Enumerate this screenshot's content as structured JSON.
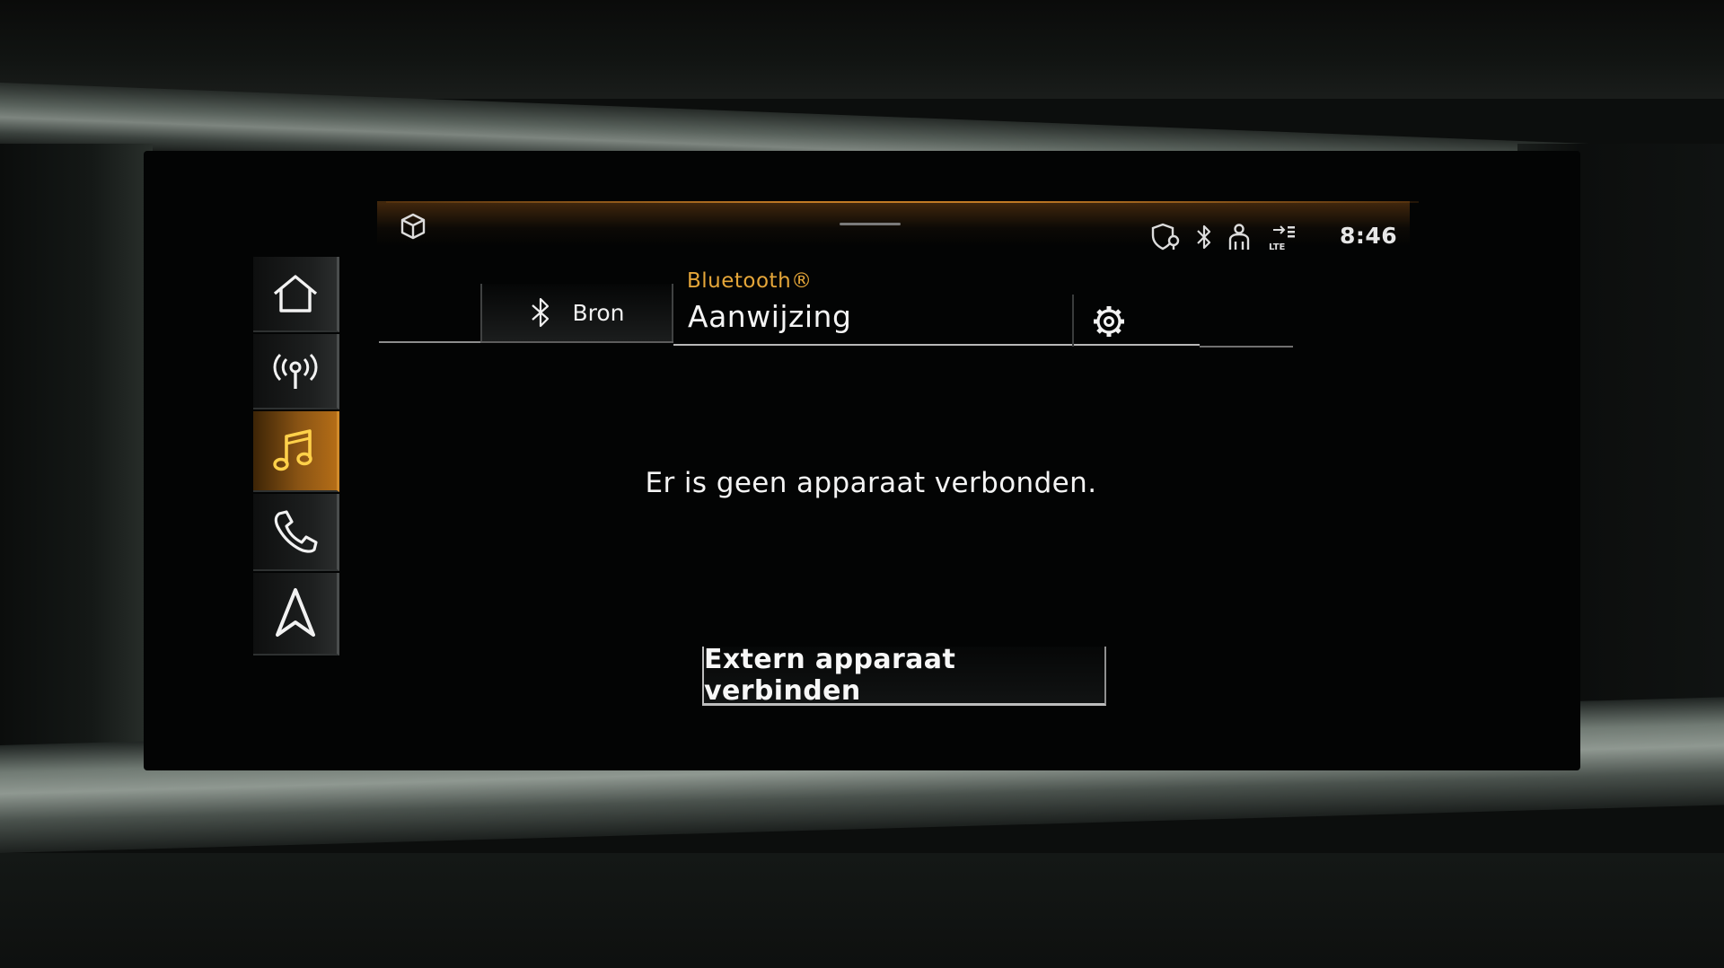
{
  "status_bar": {
    "time": "8:46",
    "icons": [
      "cube-icon",
      "shield-location-icon",
      "bluetooth-icon",
      "person-icon",
      "lte-signal-icon"
    ]
  },
  "nav_rail": {
    "items": [
      {
        "icon": "home-icon",
        "active": false
      },
      {
        "icon": "radio-antenna-icon",
        "active": false
      },
      {
        "icon": "music-note-icon",
        "active": true
      },
      {
        "icon": "phone-icon",
        "active": false
      },
      {
        "icon": "navigation-arrow-icon",
        "active": false
      }
    ]
  },
  "header": {
    "source_tab_label": "Bron",
    "source_name": "Bluetooth®",
    "title": "Aanwijzing"
  },
  "main": {
    "message": "Er is geen apparaat verbonden.",
    "connect_button_label": "Extern apparaat verbinden"
  },
  "colors": {
    "accent": "#e5a639",
    "active_tab": "#b46d17",
    "background": "#030404",
    "text": "#f4f4f4"
  }
}
